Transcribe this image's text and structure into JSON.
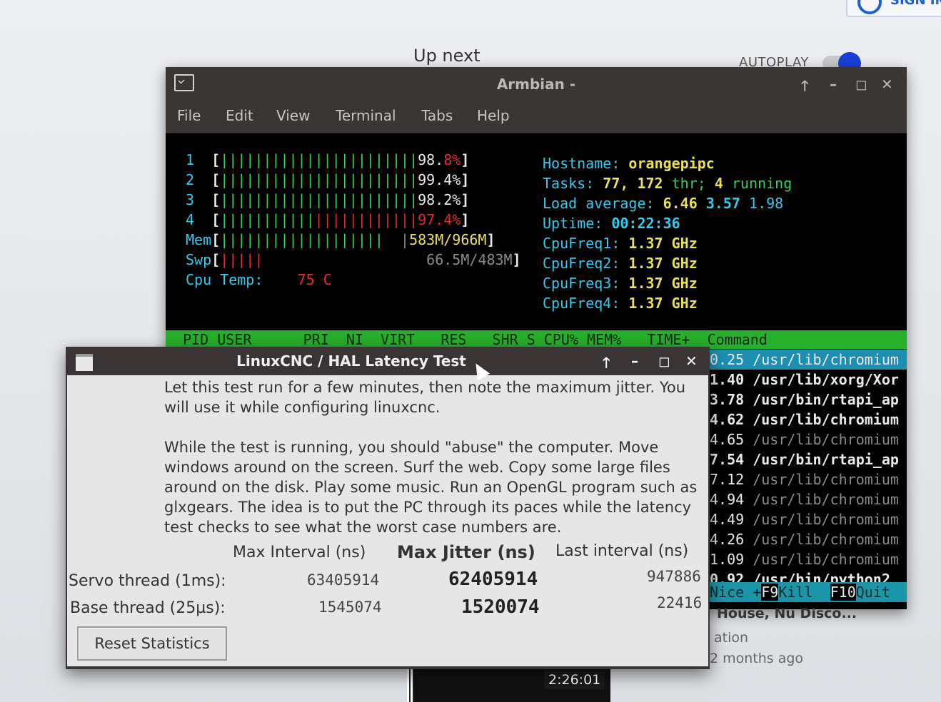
{
  "browser": {
    "up_next": "Up next",
    "autoplay": "AUTOPLAY",
    "video_title_partial": "House, Nu Disco...",
    "video_meta_partial": "ation",
    "video_age": "2 months ago",
    "duration": "2:26:01"
  },
  "terminal": {
    "title": "Armbian -",
    "menu": [
      "File",
      "Edit",
      "View",
      "Terminal",
      "Tabs",
      "Help"
    ],
    "cpu_bars": [
      {
        "label": "1",
        "percent": "98.8%"
      },
      {
        "label": "2",
        "percent": "99.4%"
      },
      {
        "label": "3",
        "percent": "98.2%"
      },
      {
        "label": "4",
        "percent": "97.4%"
      }
    ],
    "mem": {
      "label": "Mem",
      "value": "583M/966M"
    },
    "swp": {
      "label": "Swp",
      "value": "66.5M/483M"
    },
    "cpu_temp": {
      "label": "Cpu Temp:",
      "value": "75 C"
    },
    "info": {
      "hostname_label": "Hostname:",
      "hostname": "orangepipc",
      "tasks_label": "Tasks:",
      "tasks": "77,",
      "thr_count": "172",
      "thr_label": "thr;",
      "running_count": "4",
      "running_label": "running",
      "load_label": "Load average:",
      "load1": "6.46",
      "load5": "3.57",
      "load15": "1.98",
      "uptime_label": "Uptime:",
      "uptime": "00:22:36",
      "freq": [
        {
          "label": "CpuFreq1:",
          "value": "1.37 GHz"
        },
        {
          "label": "CpuFreq2:",
          "value": "1.37 GHz"
        },
        {
          "label": "CpuFreq3:",
          "value": "1.37 GHz"
        },
        {
          "label": "CpuFreq4:",
          "value": "1.37 GHz"
        }
      ]
    },
    "columns": "  PID USER      PRI  NI  VIRT   RES   SHR S CPU% MEM%   TIME+  Command",
    "processes": [
      {
        "time": "0.25",
        "cmd": "/usr/lib/chromium"
      },
      {
        "time": "1.40",
        "cmd": "/usr/lib/xorg/Xor"
      },
      {
        "time": "3.78",
        "cmd": "/usr/bin/rtapi_ap"
      },
      {
        "time": "4.62",
        "cmd": "/usr/lib/chromium"
      },
      {
        "time": "4.65",
        "cmd": "/usr/lib/chromium"
      },
      {
        "time": "7.54",
        "cmd": "/usr/bin/rtapi_ap"
      },
      {
        "time": "7.12",
        "cmd": "/usr/lib/chromium"
      },
      {
        "time": "4.94",
        "cmd": "/usr/lib/chromium"
      },
      {
        "time": "4.49",
        "cmd": "/usr/lib/chromium"
      },
      {
        "time": "4.26",
        "cmd": "/usr/lib/chromium"
      },
      {
        "time": "1.09",
        "cmd": "/usr/lib/chromium"
      },
      {
        "time": "0.92",
        "cmd": "/usr/bin/python2"
      }
    ],
    "fkeys": {
      "nice": "Nice +",
      "f9": "F9",
      "kill": "Kill",
      "f10": "F10",
      "quit": "Quit"
    }
  },
  "dialog": {
    "title": "LinuxCNC / HAL Latency Test",
    "para1_line1": "Let this test run for a few minutes, then note the maximum jitter.  You",
    "para1_line2": "will use it while configuring linuxcnc.",
    "para2": [
      "While the test is running, you should \"abuse\" the computer. Move",
      "windows around on the screen. Surf the web. Copy some large files",
      "around on the disk. Play some music. Run an OpenGL program such as",
      "glxgears. The idea is to put the PC through its paces while the latency",
      "test checks to see what the worst case numbers are."
    ],
    "col_max_interval": "Max Interval (ns)",
    "col_max_jitter": "Max Jitter (ns)",
    "col_last_interval": "Last interval (ns)",
    "rows": [
      {
        "label": "Servo thread (1ms):",
        "max_interval": "63405914",
        "max_jitter": "62405914",
        "last_interval": "947886"
      },
      {
        "label": "Base thread (25µs):",
        "max_interval": "1545074",
        "max_jitter": "1520074",
        "last_interval": "22416"
      }
    ],
    "reset_button": "Reset Statistics"
  }
}
